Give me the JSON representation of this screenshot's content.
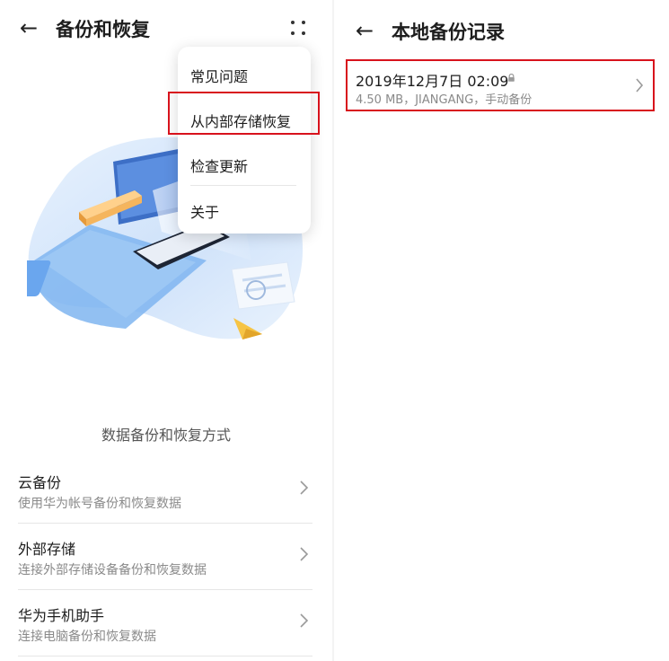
{
  "left_screen": {
    "back_glyph": "←",
    "title": "备份和恢复",
    "more_icon": "more-vertical-dots-icon",
    "menu": {
      "items": [
        "常见问题",
        "从内部存储恢复",
        "检查更新",
        "关于"
      ],
      "highlighted_index": 1
    },
    "section_title": "数据备份和恢复方式",
    "options": [
      {
        "title": "云备份",
        "subtitle": "使用华为帐号备份和恢复数据"
      },
      {
        "title": "外部存储",
        "subtitle": "连接外部存储设备备份和恢复数据"
      },
      {
        "title": "华为手机助手",
        "subtitle": "连接电脑备份和恢复数据"
      }
    ]
  },
  "right_screen": {
    "back_glyph": "←",
    "title": "本地备份记录",
    "record": {
      "date_time": "2019年12月7日 02:09",
      "details": "4.50 MB，JIANGANG，手动备份"
    }
  },
  "colors": {
    "highlight_border": "#d8121c",
    "illustration_blue": "#5b9ee9",
    "illustration_orange": "#f5b55d"
  }
}
